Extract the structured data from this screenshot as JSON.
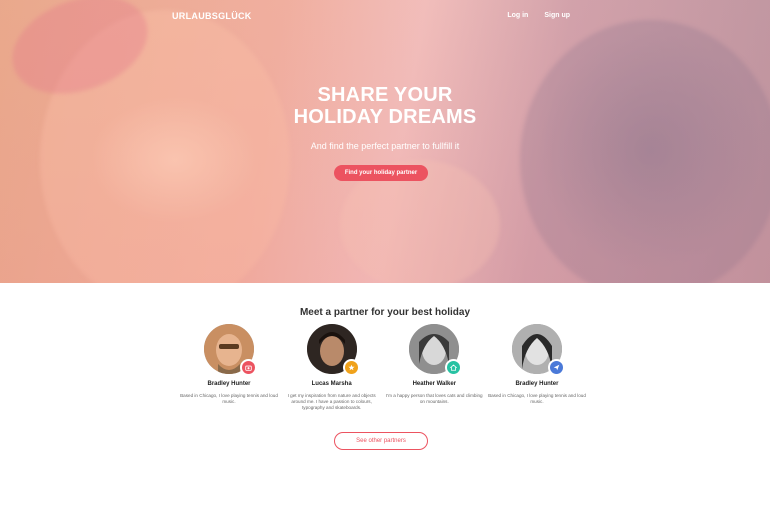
{
  "nav": {
    "logo": "URLAUBSGLÜCK",
    "login": "Log in",
    "signup": "Sign up"
  },
  "hero": {
    "title_line1": "SHARE YOUR",
    "title_line2": "HOLIDAY DREAMS",
    "subtitle": "And find the perfect partner to fullfill it",
    "cta": "Find your holiday partner"
  },
  "section": {
    "title": "Meet a partner for your best holiday",
    "see_more": "See other partners"
  },
  "partners": [
    {
      "name": "Bradley Hunter",
      "desc": "Based in Chicago, I love playing tennis and loud music.",
      "badge_icon": "camera-icon",
      "badge_color": "#ec5360"
    },
    {
      "name": "Lucas Marsha",
      "desc": "I get my inspiration from nature and objects around me. I have a passion to colours, typography and skateboards.",
      "badge_icon": "star-icon",
      "badge_color": "#f0a21b"
    },
    {
      "name": "Heather Walker",
      "desc": "I'm a happy person that loves cats and climbing on mountains.",
      "badge_icon": "home-icon",
      "badge_color": "#27c2a3"
    },
    {
      "name": "Bradley Hunter",
      "desc": "Based in Chicago, I love playing tennis and loud music.",
      "badge_icon": "send-icon",
      "badge_color": "#4a79d8"
    }
  ]
}
